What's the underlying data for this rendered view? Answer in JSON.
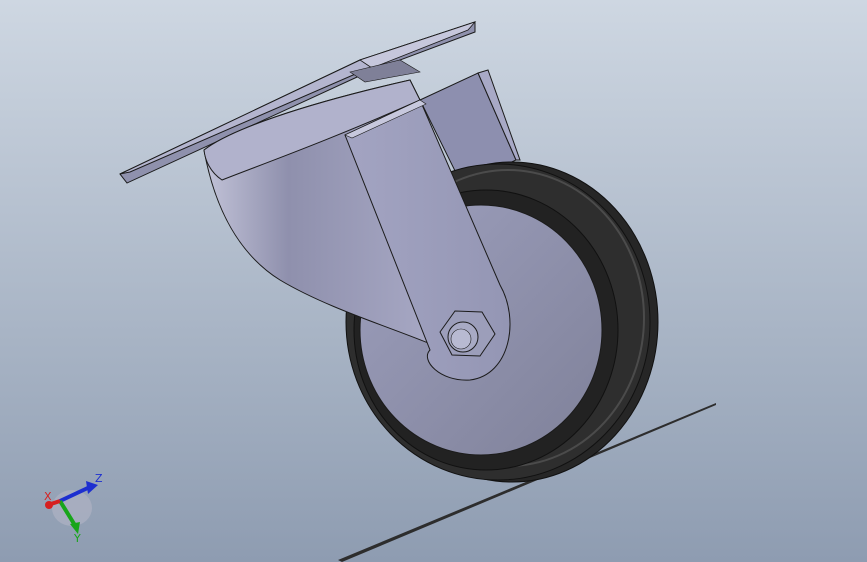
{
  "viewport": {
    "background_top": "#ced7e2",
    "background_bottom": "#8e9cb1"
  },
  "model": {
    "plate_color": "#a6a8c4",
    "body_color": "#9fa0bf",
    "tire_color": "#2b2b2b",
    "hub_color": "#8e90b0",
    "ground_color": "#2d2d2d"
  },
  "triad": {
    "x_label": "X",
    "y_label": "Y",
    "z_label": "Z",
    "x_color": "#d62020",
    "y_color": "#17a51a",
    "z_color": "#1d2fd0"
  }
}
